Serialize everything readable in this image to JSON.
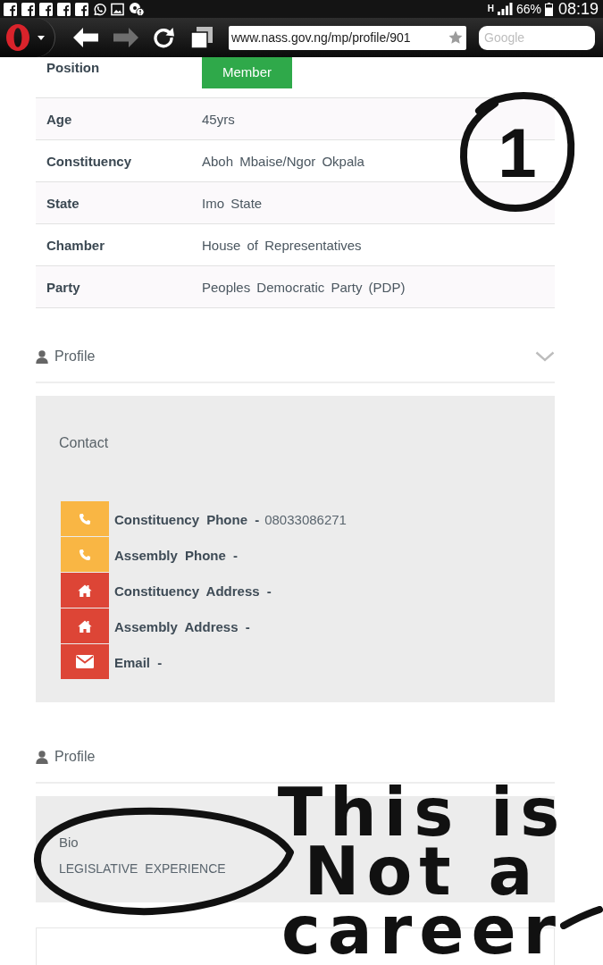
{
  "status_bar": {
    "network_type": "H",
    "battery": "66%",
    "time": "08:19"
  },
  "browser": {
    "back_disabled": false,
    "forward_disabled": true,
    "url": "www.nass.gov.ng/mp/profile/901",
    "search": {
      "placeholder": "Google"
    }
  },
  "details": [
    {
      "label": "Position",
      "value": "Member",
      "kind": "badge"
    },
    {
      "label": "Age",
      "value": "45yrs",
      "kind": "text"
    },
    {
      "label": "Constituency",
      "value": "Aboh Mbaise/Ngor Okpala",
      "kind": "text"
    },
    {
      "label": "State",
      "value": "Imo State",
      "kind": "text"
    },
    {
      "label": "Chamber",
      "value": "House of Representatives",
      "kind": "text"
    },
    {
      "label": "Party",
      "value": "Peoples Democratic Party (PDP)",
      "kind": "text"
    }
  ],
  "sections": [
    {
      "title": "Profile",
      "toggle": true,
      "panel": {
        "kind": "contact",
        "heading": "Contact",
        "items": [
          {
            "kind": "phone",
            "color": "#f9b644",
            "label": "Constituency Phone",
            "separator": "-",
            "value": "08033086271"
          },
          {
            "kind": "phone",
            "color": "#f9b644",
            "label": "Assembly Phone",
            "separator": "-"
          },
          {
            "kind": "home",
            "color": "#dd4536",
            "label": "Constituency Address",
            "separator": "-"
          },
          {
            "kind": "home",
            "color": "#dd4536",
            "label": "Assembly Address",
            "separator": "-"
          },
          {
            "kind": "email",
            "color": "#dd4536",
            "label": "Email",
            "separator": "-"
          }
        ]
      }
    },
    {
      "title": "Profile",
      "toggle": false,
      "panel": {
        "kind": "bio",
        "heading": "Bio",
        "text": "LEGISLATIVE EXPERIENCE"
      }
    }
  ],
  "annotations": {
    "circled_number": "1",
    "note": "This is Not a career"
  }
}
